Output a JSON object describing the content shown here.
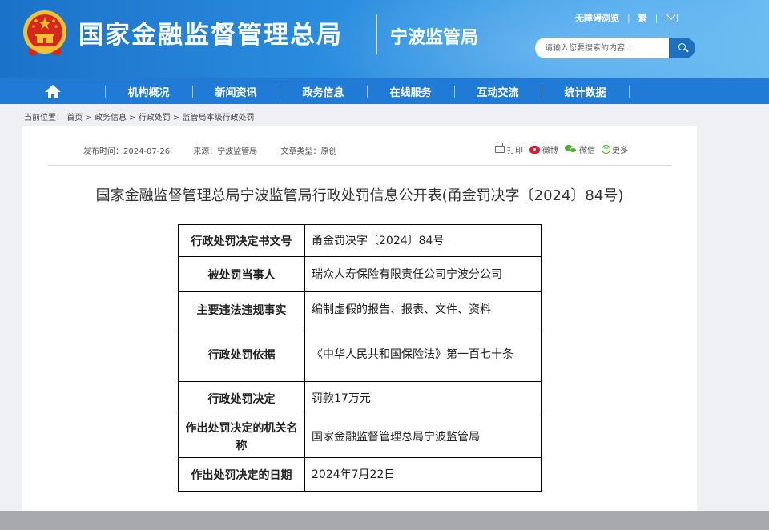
{
  "header": {
    "site_title": "国家金融监督管理总局",
    "sub_title": "宁波监管局",
    "top_links": [
      "无障碍浏览",
      "繁"
    ],
    "search_placeholder": "请输入您要搜索的内容...",
    "colors": {
      "header_start": "#1b72c9",
      "header_end": "#6bbcf2",
      "nav": "#1f7bd6"
    }
  },
  "nav": {
    "items": [
      "机构概况",
      "新闻资讯",
      "政务信息",
      "在线服务",
      "互动交流",
      "统计数据"
    ]
  },
  "breadcrumb": {
    "label": "当前位置：",
    "items": [
      "首页",
      "政务信息",
      "行政处罚",
      "监管局本级行政处罚"
    ],
    "separator": ">"
  },
  "article": {
    "publish_time": "发布时间：2024-07-26",
    "source": "来源：宁波监管局",
    "doc_type": "文章类型：原创",
    "share": {
      "print": "打印",
      "weibo": "微博",
      "wechat": "微信",
      "more": "更多"
    },
    "title": "国家金融监督管理总局宁波监管局行政处罚信息公开表(甬金罚决字〔2024〕84号)"
  },
  "table": {
    "rows": [
      {
        "key": "行政处罚决定书文号",
        "value": "甬金罚决字〔2024〕84号"
      },
      {
        "key": "被处罚当事人",
        "value": "瑞众人寿保险有限责任公司宁波分公司"
      },
      {
        "key": "主要违法违规事实",
        "value": "编制虚假的报告、报表、文件、资料"
      },
      {
        "key": "行政处罚依据",
        "value": "《中华人民共和国保险法》第一百七十条"
      },
      {
        "key": "行政处罚决定",
        "value": "罚款17万元"
      },
      {
        "key": "作出处罚决定的机关名称",
        "value": "国家金融监督管理总局宁波监管局"
      },
      {
        "key": "作出处罚决定的日期",
        "value": "2024年7月22日"
      }
    ]
  }
}
